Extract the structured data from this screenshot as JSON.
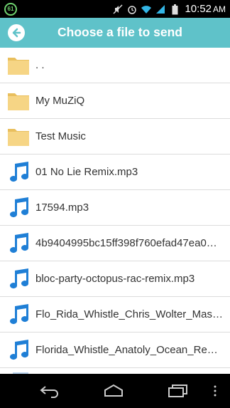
{
  "status_bar": {
    "badge": "61",
    "time": "10:52",
    "ampm": "AM",
    "icons": [
      "mute-icon",
      "alarm-icon",
      "wifi-icon",
      "signal-icon",
      "battery-icon"
    ]
  },
  "header": {
    "title": "Choose a file to send",
    "back_icon": "back-arrow-icon",
    "accent": "#5fc2c9"
  },
  "files": [
    {
      "label": ". .",
      "type": "folder"
    },
    {
      "label": "My MuZiQ",
      "type": "folder"
    },
    {
      "label": "Test Music",
      "type": "folder"
    },
    {
      "label": "01 No Lie Remix.mp3",
      "type": "audio"
    },
    {
      "label": "17594.mp3",
      "type": "audio"
    },
    {
      "label": "4b9404995bc15ff398f760efad47ea0…",
      "type": "audio"
    },
    {
      "label": "bloc-party-octopus-rac-remix.mp3",
      "type": "audio"
    },
    {
      "label": "Flo_Rida_Whistle_Chris_Wolter_Mas…",
      "type": "audio"
    },
    {
      "label": "Florida_Whistle_Anatoly_Ocean_Re…",
      "type": "audio"
    }
  ],
  "nav_bar": {
    "icons": [
      "back-nav-icon",
      "home-icon",
      "recent-apps-icon",
      "menu-icon"
    ]
  }
}
